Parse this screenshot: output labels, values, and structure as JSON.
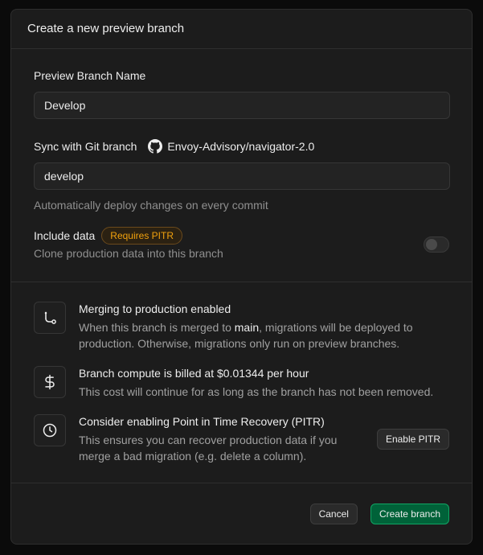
{
  "dialog": {
    "title": "Create a new preview branch"
  },
  "form": {
    "branch_name_label": "Preview Branch Name",
    "branch_name_value": "Develop",
    "git_label": "Sync with Git branch",
    "repo_name": "Envoy-Advisory/navigator-2.0",
    "git_branch_value": "develop",
    "git_helper": "Automatically deploy changes on every commit",
    "include_data_label": "Include data",
    "pitr_badge": "Requires PITR",
    "include_data_helper": "Clone production data into this branch",
    "include_data_enabled": false
  },
  "info": {
    "merge_title": "Merging to production enabled",
    "merge_desc_prefix": "When this branch is merged to ",
    "merge_desc_branch": "main",
    "merge_desc_suffix": ", migrations will be deployed to production. Otherwise, migrations only run on preview branches.",
    "billing_title": "Branch compute is billed at $0.01344 per hour",
    "billing_desc": "This cost will continue for as long as the branch has not been removed.",
    "pitr_title": "Consider enabling Point in Time Recovery (PITR)",
    "pitr_desc": "This ensures you can recover production data if you merge a bad migration (e.g. delete a column).",
    "pitr_button": "Enable PITR"
  },
  "footer": {
    "cancel_label": "Cancel",
    "create_label": "Create branch"
  },
  "colors": {
    "background": "#1c1c1c",
    "primary": "#006239",
    "warning": "#f1a10d"
  },
  "icons": {
    "repo": "github-icon",
    "merge": "git-merge-icon",
    "billing": "dollar-icon",
    "pitr": "clock-icon"
  }
}
